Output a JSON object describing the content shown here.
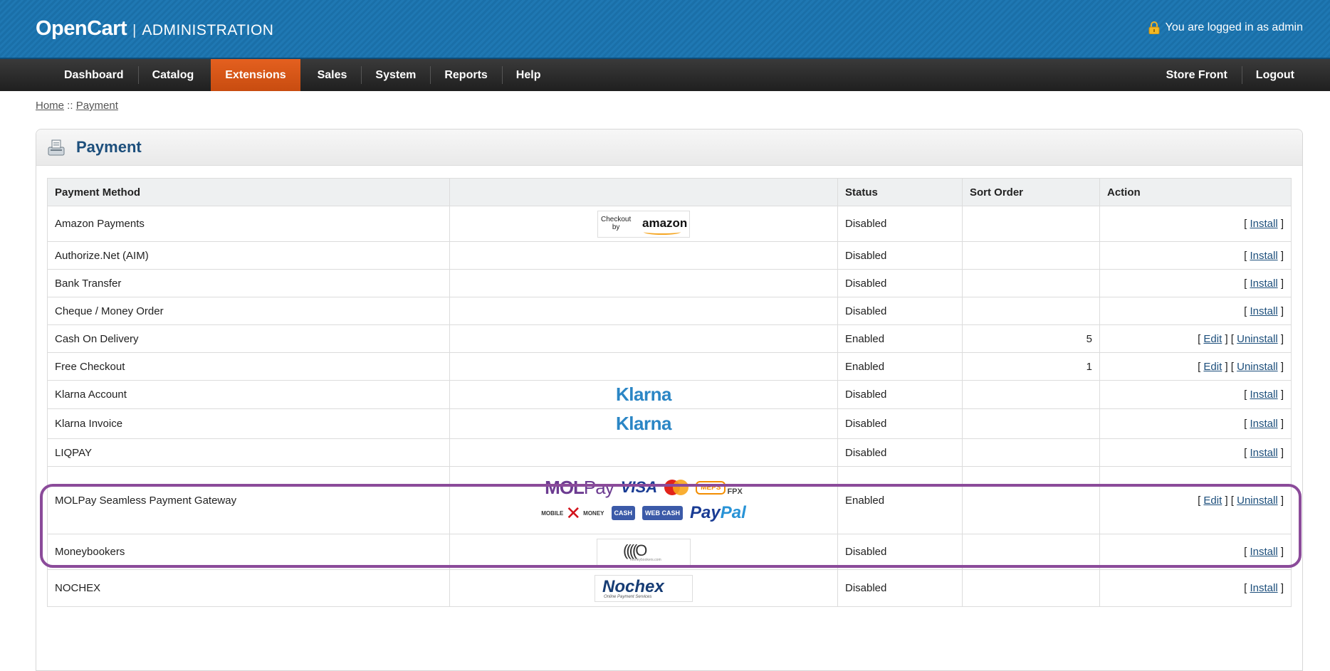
{
  "header": {
    "brand": "OpenCart",
    "separator": "|",
    "subtitle": "ADMINISTRATION",
    "logged_in": "You are logged in as admin",
    "lock_icon": "padlock-icon"
  },
  "menu": {
    "left": [
      {
        "label": "Dashboard",
        "active": false
      },
      {
        "label": "Catalog",
        "active": false
      },
      {
        "label": "Extensions",
        "active": true
      },
      {
        "label": "Sales",
        "active": false
      },
      {
        "label": "System",
        "active": false
      },
      {
        "label": "Reports",
        "active": false
      },
      {
        "label": "Help",
        "active": false
      }
    ],
    "right": [
      {
        "label": "Store Front"
      },
      {
        "label": "Logout"
      }
    ],
    "active_color": "#e4601f"
  },
  "breadcrumb": {
    "home": "Home",
    "sep": " :: ",
    "current": "Payment"
  },
  "panel": {
    "title": "Payment",
    "icon": "payment-icon"
  },
  "table": {
    "headers": {
      "method": "Payment Method",
      "logo": "",
      "status": "Status",
      "sort": "Sort Order",
      "action": "Action"
    },
    "rows": [
      {
        "name": "Amazon Payments",
        "logo": "amazon",
        "status": "Disabled",
        "sort": "",
        "actions": [
          "Install"
        ]
      },
      {
        "name": "Authorize.Net (AIM)",
        "logo": "",
        "status": "Disabled",
        "sort": "",
        "actions": [
          "Install"
        ]
      },
      {
        "name": "Bank Transfer",
        "logo": "",
        "status": "Disabled",
        "sort": "",
        "actions": [
          "Install"
        ]
      },
      {
        "name": "Cheque / Money Order",
        "logo": "",
        "status": "Disabled",
        "sort": "",
        "actions": [
          "Install"
        ]
      },
      {
        "name": "Cash On Delivery",
        "logo": "",
        "status": "Enabled",
        "sort": "5",
        "actions": [
          "Edit",
          "Uninstall"
        ]
      },
      {
        "name": "Free Checkout",
        "logo": "",
        "status": "Enabled",
        "sort": "1",
        "actions": [
          "Edit",
          "Uninstall"
        ]
      },
      {
        "name": "Klarna Account",
        "logo": "klarna",
        "status": "Disabled",
        "sort": "",
        "actions": [
          "Install"
        ]
      },
      {
        "name": "Klarna Invoice",
        "logo": "klarna",
        "status": "Disabled",
        "sort": "",
        "actions": [
          "Install"
        ]
      },
      {
        "name": "LIQPAY",
        "logo": "",
        "status": "Disabled",
        "sort": "",
        "actions": [
          "Install"
        ]
      },
      {
        "name": "MOLPay Seamless Payment Gateway",
        "logo": "molpay",
        "status": "Enabled",
        "sort": "",
        "actions": [
          "Edit",
          "Uninstall"
        ]
      },
      {
        "name": "Moneybookers",
        "logo": "moneybookers",
        "status": "Disabled",
        "sort": "",
        "actions": [
          "Install"
        ]
      },
      {
        "name": "NOCHEX",
        "logo": "nochex",
        "status": "Disabled",
        "sort": "",
        "actions": [
          "Install"
        ]
      }
    ]
  },
  "logos": {
    "amazon": {
      "checkout": "Checkout",
      "by": "by",
      "brand": "amazon"
    },
    "klarna": {
      "text": "Klarna"
    },
    "molpay": {
      "brand_a": "MOL",
      "brand_b": "Pay",
      "visa": "VISA",
      "meps": "MEPS",
      "fpx": "FPX",
      "mobile": "MOBILE",
      "money": "MONEY",
      "cash": "CASH",
      "webcash": "WEB CASH",
      "paypal_a": "Pay",
      "paypal_b": "Pal"
    },
    "moneybookers": {
      "waves": "((((O",
      "site": "moneybookers.com"
    },
    "nochex": {
      "text": "Nochex",
      "sub": "Online Payment Services"
    }
  },
  "highlight_color": "#8b4b9a"
}
